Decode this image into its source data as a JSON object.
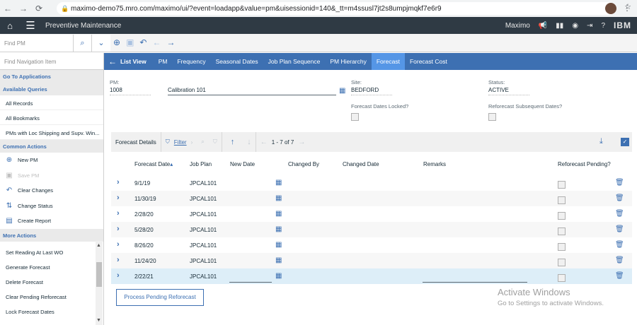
{
  "browser": {
    "url": "maximo-demo75.mro.com/maximo/ui/?event=loadapp&value=pm&uisessionid=140&_tt=m4ssusl7jt2s8umpjmqkf7e6r9"
  },
  "appbar": {
    "title": "Preventive Maintenance",
    "user": "Maximo",
    "brand": "IBM"
  },
  "toolbar": {
    "find_placeholder": "Find PM"
  },
  "sidebar": {
    "find_placeholder": "Find Navigation Item",
    "go_to_apps": "Go To Applications",
    "queries_head": "Available Queries",
    "queries": [
      "All Records",
      "All Bookmarks",
      "PMs with Loc Shipping and Supv. Win..."
    ],
    "common_head": "Common Actions",
    "common": [
      "New PM",
      "Save PM",
      "Clear Changes",
      "Change Status",
      "Create Report"
    ],
    "more_head": "More Actions",
    "more": [
      "Set Reading At Last WO",
      "Generate Forecast",
      "Delete Forecast",
      "Clear Pending Reforecast",
      "Lock Forecast Dates"
    ]
  },
  "tabs": {
    "back_label": "List View",
    "items": [
      "PM",
      "Frequency",
      "Seasonal Dates",
      "Job Plan Sequence",
      "PM Hierarchy",
      "Forecast",
      "Forecast Cost"
    ],
    "active": "Forecast"
  },
  "form": {
    "pm_label": "PM:",
    "pm_value": "1008",
    "desc_value": "Calibration 101",
    "site_label": "Site:",
    "site_value": "BEDFORD",
    "status_label": "Status:",
    "status_value": "ACTIVE",
    "locked_label": "Forecast Dates Locked?",
    "reforecast_label": "Reforecast Subsequent Dates?"
  },
  "grid": {
    "title": "Forecast Details",
    "filter_label": "Filter",
    "page_info": "1 - 7 of 7",
    "columns": [
      "Forecast Date",
      "Job Plan",
      "New Date",
      "Changed By",
      "Changed Date",
      "Remarks",
      "Reforecast Pending?"
    ],
    "rows": [
      {
        "date": "9/1/19",
        "plan": "JPCAL101"
      },
      {
        "date": "11/30/19",
        "plan": "JPCAL101"
      },
      {
        "date": "2/28/20",
        "plan": "JPCAL101"
      },
      {
        "date": "5/28/20",
        "plan": "JPCAL101"
      },
      {
        "date": "8/26/20",
        "plan": "JPCAL101"
      },
      {
        "date": "11/24/20",
        "plan": "JPCAL101"
      },
      {
        "date": "2/22/21",
        "plan": "JPCAL101"
      }
    ],
    "process_button": "Process Pending Reforecast"
  },
  "watermark": {
    "line1": "Activate Windows",
    "line2": "Go to Settings to activate Windows."
  },
  "colors": {
    "appbar": "#2f3a44",
    "accent": "#3d70b2",
    "active_tab": "#5596e6",
    "selected_row": "#ddeef8"
  }
}
